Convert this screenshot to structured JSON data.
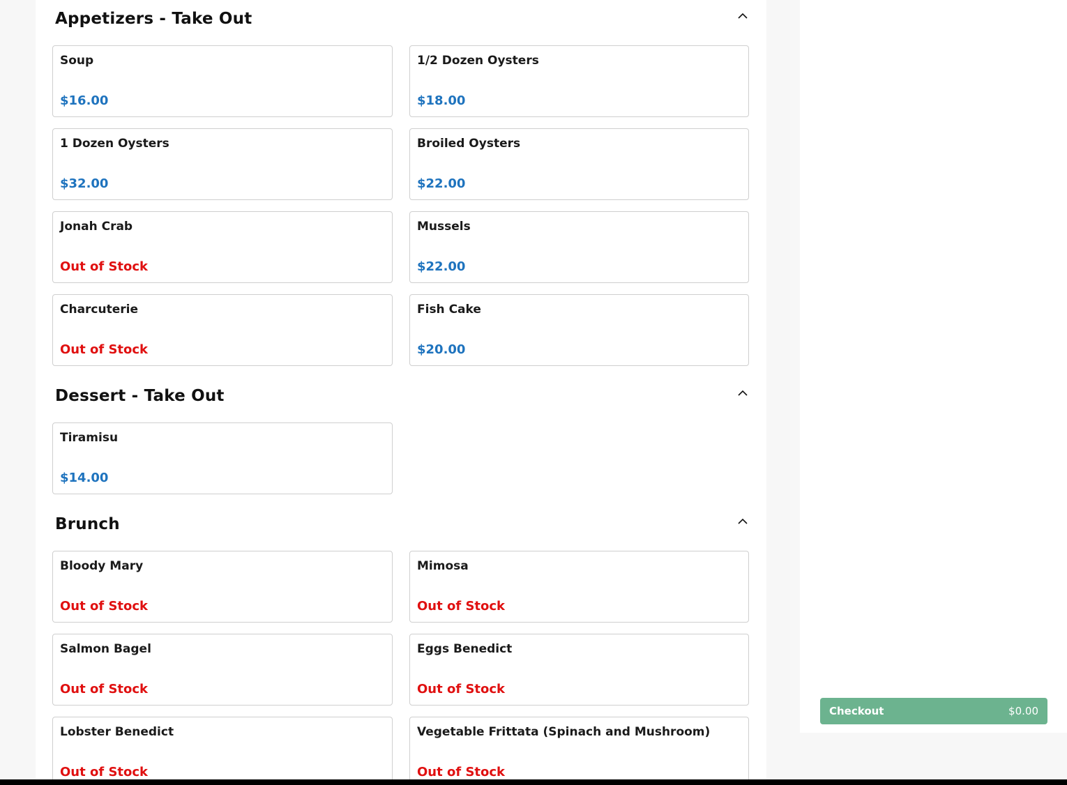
{
  "colors": {
    "price": "#1e73be",
    "out_of_stock": "#e01010",
    "checkout_bg": "#6cb38f",
    "page_bg": "#f7f7f7"
  },
  "sections": [
    {
      "title": "Appetizers - Take Out",
      "toggle_icon": "chevron-up-icon",
      "items": [
        {
          "name": "Soup",
          "price": "$16.00",
          "out_of_stock": false
        },
        {
          "name": "1/2 Dozen Oysters",
          "price": "$18.00",
          "out_of_stock": false
        },
        {
          "name": "1 Dozen Oysters",
          "price": "$32.00",
          "out_of_stock": false
        },
        {
          "name": "Broiled Oysters",
          "price": "$22.00",
          "out_of_stock": false
        },
        {
          "name": "Jonah Crab",
          "price": "Out of Stock",
          "out_of_stock": true
        },
        {
          "name": "Mussels",
          "price": "$22.00",
          "out_of_stock": false
        },
        {
          "name": "Charcuterie",
          "price": "Out of Stock",
          "out_of_stock": true
        },
        {
          "name": "Fish Cake",
          "price": "$20.00",
          "out_of_stock": false
        }
      ]
    },
    {
      "title": "Dessert - Take Out",
      "toggle_icon": "chevron-up-icon",
      "items": [
        {
          "name": "Tiramisu",
          "price": "$14.00",
          "out_of_stock": false
        }
      ]
    },
    {
      "title": "Brunch",
      "toggle_icon": "chevron-up-icon",
      "items": [
        {
          "name": "Bloody Mary",
          "price": "Out of Stock",
          "out_of_stock": true
        },
        {
          "name": "Mimosa",
          "price": "Out of Stock",
          "out_of_stock": true
        },
        {
          "name": "Salmon Bagel",
          "price": "Out of Stock",
          "out_of_stock": true
        },
        {
          "name": "Eggs Benedict",
          "price": "Out of Stock",
          "out_of_stock": true
        },
        {
          "name": "Lobster Benedict",
          "price": "Out of Stock",
          "out_of_stock": true
        },
        {
          "name": "Vegetable Frittata (Spinach and Mushroom)",
          "price": "Out of Stock",
          "out_of_stock": true
        }
      ]
    }
  ],
  "cart": {
    "checkout_label": "Checkout",
    "total": "$0.00"
  }
}
